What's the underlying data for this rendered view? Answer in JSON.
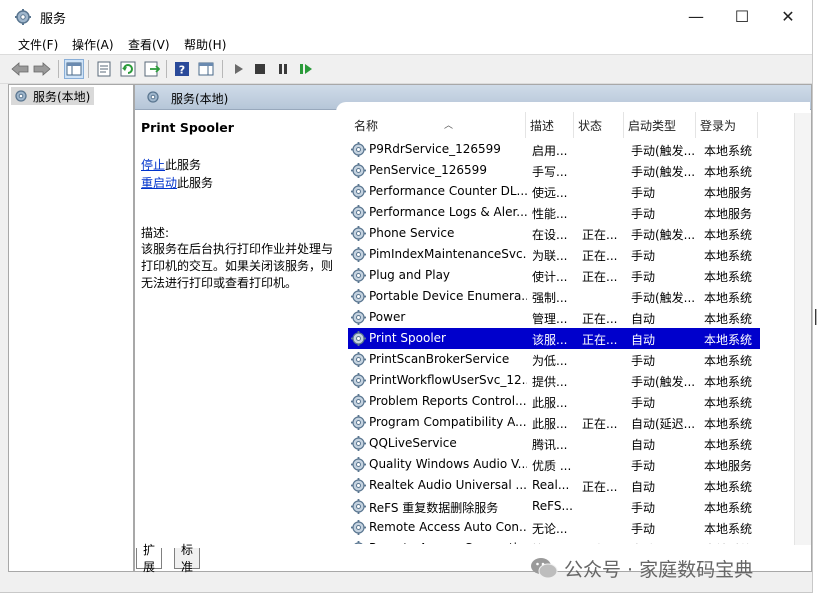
{
  "window": {
    "title": "服务",
    "controls": {
      "minimize": "—",
      "maximize": "☐",
      "close": "✕"
    }
  },
  "menu": [
    "文件(F)",
    "操作(A)",
    "查看(V)",
    "帮助(H)"
  ],
  "toolbar_icons": [
    "back-arrow-icon",
    "forward-arrow-icon",
    "show-hide-console-tree-icon",
    "properties-icon",
    "refresh-icon",
    "export-list-icon",
    "help-icon",
    "show-hide-action-pane-icon",
    "start-service-icon",
    "stop-service-icon",
    "pause-service-icon",
    "restart-service-icon"
  ],
  "tree": {
    "root_label": "服务(本地)"
  },
  "pane_header": "服务(本地)",
  "description_panel": {
    "service_name": "Print Spooler",
    "stop_link": "停止",
    "stop_suffix": "此服务",
    "restart_link": "重启动",
    "restart_suffix": "此服务",
    "desc_label": "描述:",
    "desc_text": "该服务在后台执行打印作业并处理与打印机的交互。如果关闭该服务，则无法进行打印或查看打印机。"
  },
  "columns": [
    "名称",
    "描述",
    "状态",
    "启动类型",
    "登录为"
  ],
  "services": [
    {
      "name": "P9RdrService_126599",
      "desc": "启用...",
      "status": "",
      "startup": "手动(触发...",
      "logon": "本地系统",
      "selected": false
    },
    {
      "name": "PenService_126599",
      "desc": "手写...",
      "status": "",
      "startup": "手动(触发...",
      "logon": "本地系统",
      "selected": false
    },
    {
      "name": "Performance Counter DL...",
      "desc": "使远...",
      "status": "",
      "startup": "手动",
      "logon": "本地服务",
      "selected": false
    },
    {
      "name": "Performance Logs & Aler...",
      "desc": "性能...",
      "status": "",
      "startup": "手动",
      "logon": "本地服务",
      "selected": false
    },
    {
      "name": "Phone Service",
      "desc": "在设...",
      "status": "正在...",
      "startup": "手动(触发...",
      "logon": "本地系统",
      "selected": false
    },
    {
      "name": "PimIndexMaintenanceSvc...",
      "desc": "为联...",
      "status": "正在...",
      "startup": "手动",
      "logon": "本地系统",
      "selected": false
    },
    {
      "name": "Plug and Play",
      "desc": "使计...",
      "status": "正在...",
      "startup": "手动",
      "logon": "本地系统",
      "selected": false
    },
    {
      "name": "Portable Device Enumera...",
      "desc": "强制...",
      "status": "",
      "startup": "手动(触发...",
      "logon": "本地系统",
      "selected": false
    },
    {
      "name": "Power",
      "desc": "管理...",
      "status": "正在...",
      "startup": "自动",
      "logon": "本地系统",
      "selected": false
    },
    {
      "name": "Print Spooler",
      "desc": "该服...",
      "status": "正在...",
      "startup": "自动",
      "logon": "本地系统",
      "selected": true
    },
    {
      "name": "PrintScanBrokerService",
      "desc": "为低...",
      "status": "",
      "startup": "手动",
      "logon": "本地系统",
      "selected": false
    },
    {
      "name": "PrintWorkflowUserSvc_12...",
      "desc": "提供...",
      "status": "",
      "startup": "手动(触发...",
      "logon": "本地系统",
      "selected": false
    },
    {
      "name": "Problem Reports Control...",
      "desc": "此服...",
      "status": "",
      "startup": "手动",
      "logon": "本地系统",
      "selected": false
    },
    {
      "name": "Program Compatibility A...",
      "desc": "此服...",
      "status": "正在...",
      "startup": "自动(延迟...",
      "logon": "本地系统",
      "selected": false
    },
    {
      "name": "QQLiveService",
      "desc": "腾讯...",
      "status": "",
      "startup": "自动",
      "logon": "本地系统",
      "selected": false
    },
    {
      "name": "Quality Windows Audio V...",
      "desc": "优质 ...",
      "status": "",
      "startup": "手动",
      "logon": "本地服务",
      "selected": false
    },
    {
      "name": "Realtek Audio Universal ...",
      "desc": "Real...",
      "status": "正在...",
      "startup": "自动",
      "logon": "本地系统",
      "selected": false
    },
    {
      "name": "ReFS 重复数据删除服务",
      "desc": "ReFS...",
      "status": "",
      "startup": "手动",
      "logon": "本地系统",
      "selected": false
    },
    {
      "name": "Remote Access Auto Con...",
      "desc": "无论...",
      "status": "",
      "startup": "手动",
      "logon": "本地系统",
      "selected": false
    },
    {
      "name": "Remote Access Connecti...",
      "desc": "管理...",
      "status": "正在...",
      "startup": "自动",
      "logon": "本地系统",
      "selected": false
    }
  ],
  "tabs": [
    "扩展",
    "标准"
  ],
  "watermark": "公众号 · 家庭数码宝典",
  "colors": {
    "selection": "#0000cc",
    "link": "#0033cc",
    "pane_header": "#c3d1e0"
  }
}
